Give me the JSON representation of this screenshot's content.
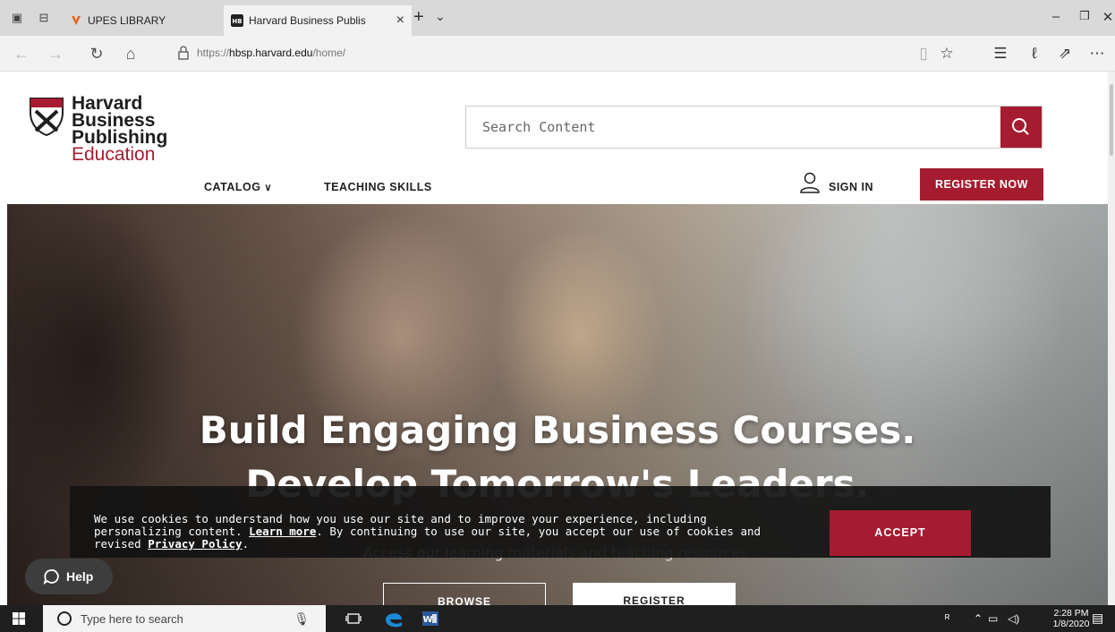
{
  "browser": {
    "tabs": [
      {
        "title": "UPES LIBRARY",
        "active": false
      },
      {
        "title": "Harvard Business Publis",
        "active": true
      }
    ],
    "url_prefix": "https://",
    "url_host": "hbsp.harvard.edu",
    "url_path": "/home/"
  },
  "header": {
    "logo": {
      "line1": "Harvard",
      "line2": "Business",
      "line3": "Publishing",
      "line4": "Education"
    },
    "search_placeholder": "Search Content",
    "nav": {
      "catalog": "CATALOG",
      "teaching_skills": "TEACHING SKILLS",
      "sign_in": "SIGN IN",
      "register_now": "REGISTER NOW"
    }
  },
  "hero": {
    "headline": "Build Engaging Business Courses.",
    "headline2": "Develop Tomorrow's Leaders.",
    "subtext": "Access our learning materials and teaching resources.",
    "browse_button": "BROWSE",
    "register_button": "REGISTER"
  },
  "cookie_banner": {
    "text1": "We use cookies to understand how you use our site and to improve your experience, including personalizing content. ",
    "learn_more": "Learn more",
    "text2": ". By continuing to use our site, you accept our use of cookies and revised ",
    "privacy_policy": "Privacy Policy",
    "text3": ".",
    "accept_button": "ACCEPT"
  },
  "help_button": "Help",
  "taskbar": {
    "search_placeholder": "Type here to search",
    "time": "2:28 PM",
    "date": "1/8/2020"
  },
  "colors": {
    "brand_crimson": "#a51c30",
    "banner_bg": "#121212"
  }
}
